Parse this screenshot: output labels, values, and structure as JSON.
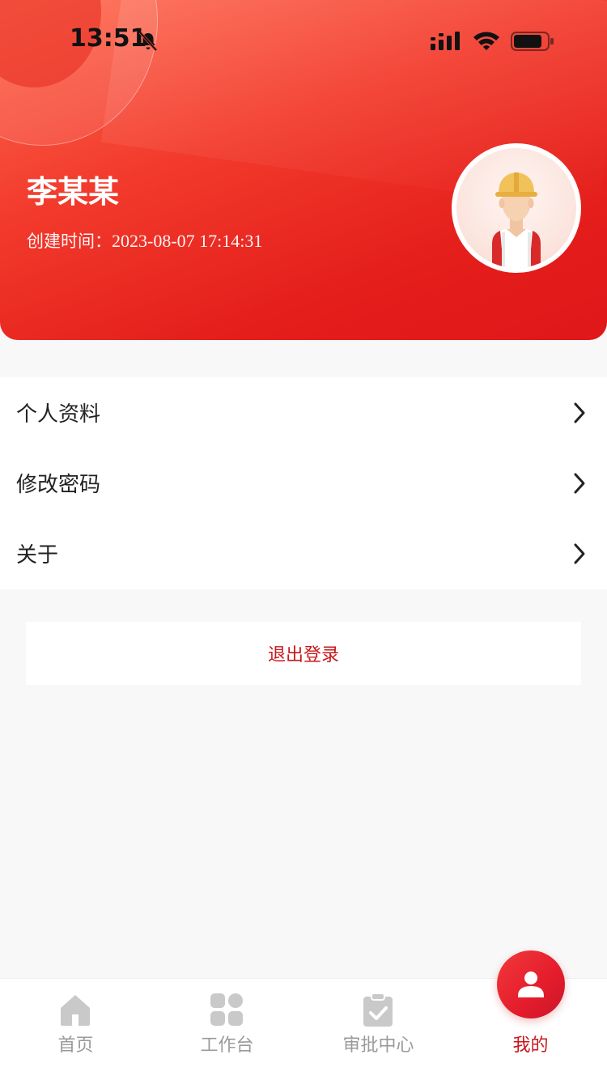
{
  "status_bar": {
    "time": "13:51"
  },
  "profile": {
    "name": "李某某",
    "created_label": "创建时间：",
    "created_value": "2023-08-07 17:14:31"
  },
  "menu": {
    "items": [
      {
        "label": "个人资料"
      },
      {
        "label": "修改密码"
      },
      {
        "label": "关于"
      }
    ]
  },
  "logout": {
    "label": "退出登录"
  },
  "tabbar": {
    "tabs": [
      {
        "label": "首页",
        "icon": "home-icon"
      },
      {
        "label": "工作台",
        "icon": "grid-icon"
      },
      {
        "label": "审批中心",
        "icon": "clipboard-check-icon"
      },
      {
        "label": "我的",
        "icon": "user-icon",
        "active": true
      }
    ]
  },
  "colors": {
    "accent": "#c8171b",
    "header_gradient_start": "#ff6a4f",
    "header_gradient_end": "#e0171a",
    "inactive_tab": "#9a9a9a"
  }
}
